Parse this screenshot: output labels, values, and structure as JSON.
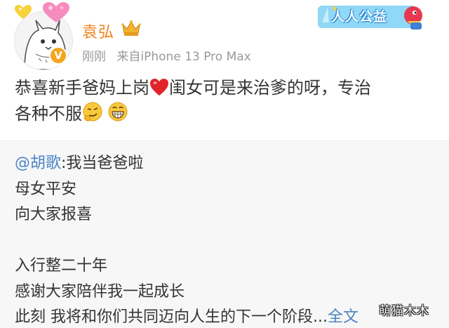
{
  "post": {
    "username": "袁弘",
    "time": "刚刚",
    "source": "来自iPhone 13 Pro Max",
    "charity_badge": "人人公益",
    "verified_mark": "V",
    "text_part1": "恭喜新手爸妈上岗",
    "text_part2": "闺女可是来治爹的呀，专治",
    "text_part3": "各种不服",
    "icons": [
      "cat-avatar",
      "crown-icon",
      "heart-icon",
      "smirk-emoji-icon",
      "grin-emoji-icon"
    ]
  },
  "repost": {
    "mention": "@胡歌",
    "first_line_rest": ":我当爸爸啦",
    "lines": [
      "母女平安",
      "向大家报喜",
      "",
      "入行整二十年",
      "感谢大家陪伴我一起成长"
    ],
    "last_line": "此刻 我将和你们共同迈向人生的下一个阶段...",
    "full_text_link": "全文"
  },
  "watermark": "萌猫木木",
  "colors": {
    "username": "#f0821e",
    "link": "#4a84c6",
    "meta": "#9a9a9a",
    "repost_bg": "#f7f7f7",
    "heart": "#e0242a"
  }
}
